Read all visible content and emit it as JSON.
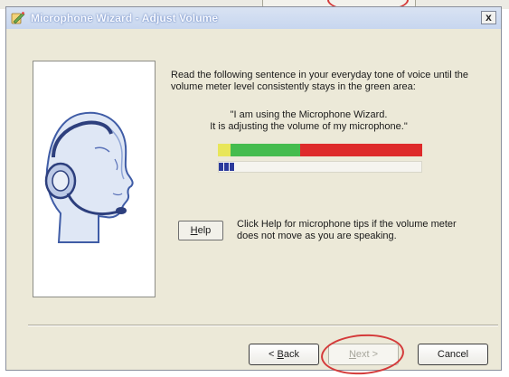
{
  "window": {
    "title": "Microphone Wizard - Adjust Volume",
    "close_glyph": "x"
  },
  "instructions": "Read the following sentence in your everyday tone of voice until the volume meter level consistently stays in the green area:",
  "quote": {
    "line1": "\"I am using the Microphone Wizard.",
    "line2": "It is adjusting the volume of my microphone.\""
  },
  "volume_meter": {
    "segments": [
      {
        "color": "#e8e65a",
        "fraction": 0.06
      },
      {
        "color": "#45bc4e",
        "fraction": 0.34
      },
      {
        "color": "#de2a2a",
        "fraction": 0.6
      }
    ],
    "current_level": 0.08
  },
  "help": {
    "button_letter": "H",
    "button_rest": "elp",
    "text": "Click Help for microphone tips if the volume meter does not move as you are speaking."
  },
  "buttons": {
    "back_prefix": "< ",
    "back_letter": "B",
    "back_rest": "ack",
    "next_letter": "N",
    "next_rest": "ext >",
    "cancel": "Cancel"
  },
  "icons": {
    "app": "microphone-wizard-icon",
    "illustration": "headset-user-icon"
  }
}
